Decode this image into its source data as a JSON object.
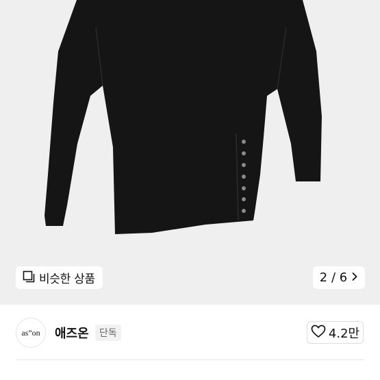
{
  "gallery": {
    "similar_label": "비슷한 상품",
    "similar_icon": "similar-products-icon",
    "pager_text": "2 / 6",
    "pager_icon": "chevron-right-icon",
    "background": "#efefef"
  },
  "brand": {
    "logo_text": "as”on",
    "name": "애즈온",
    "badge": "단독",
    "likes": "4.2만",
    "like_icon": "heart-outline-icon"
  }
}
